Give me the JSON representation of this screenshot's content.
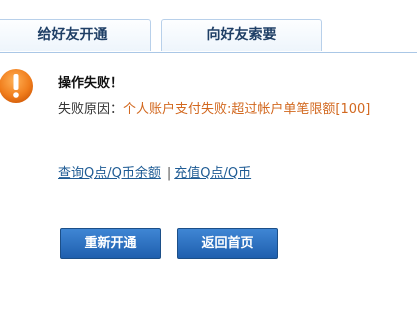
{
  "tabs": [
    {
      "label": "给好友开通"
    },
    {
      "label": "向好友索要"
    }
  ],
  "result": {
    "icon": "exclamation-icon",
    "accent_color": "#f07d1c",
    "title": "操作失败！",
    "reason_label": "失败原因：",
    "reason_text": "个人账户支付失败:超过帐户单笔限额[100]"
  },
  "links": {
    "query": "查询Q点/Q币余额",
    "separator": "|",
    "recharge": "充值Q点/Q币"
  },
  "buttons": {
    "reopen": "重新开通",
    "home": "返回首页"
  }
}
